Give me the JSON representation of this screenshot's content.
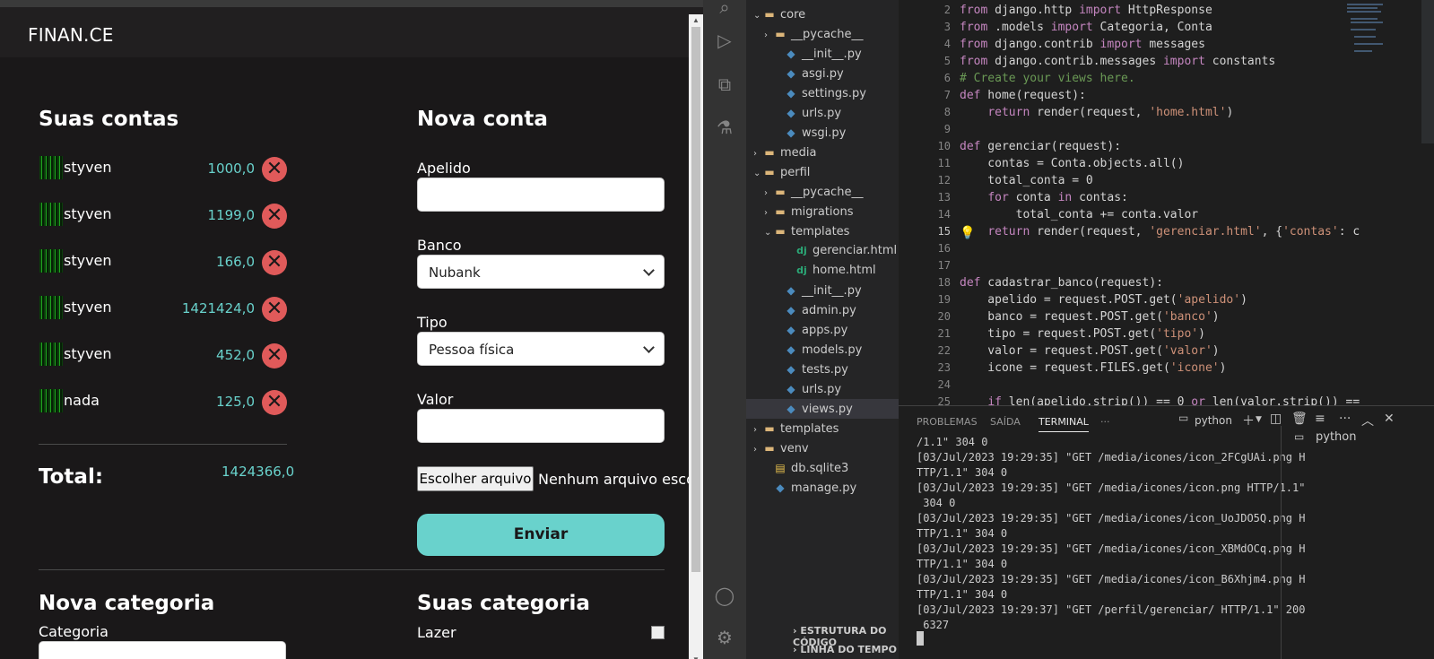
{
  "browser": {
    "brand": "FINAN.CE",
    "accounts_title": "Suas contas",
    "accounts": [
      {
        "name": "styven",
        "value": "1000,0"
      },
      {
        "name": "styven",
        "value": "1199,0"
      },
      {
        "name": "styven",
        "value": "166,0"
      },
      {
        "name": "styven",
        "value": "1421424,0"
      },
      {
        "name": "styven",
        "value": "452,0"
      },
      {
        "name": "nada",
        "value": "125,0"
      }
    ],
    "total_label": "Total:",
    "total_value": "1424366,0",
    "new_account_title": "Nova conta",
    "apelido_label": "Apelido",
    "banco_label": "Banco",
    "banco_value": "Nubank",
    "tipo_label": "Tipo",
    "tipo_value": "Pessoa física",
    "valor_label": "Valor",
    "file_button": "Escolher arquivo",
    "file_status": "Nenhum arquivo escolhido",
    "submit_button": "Enviar",
    "new_category_title": "Nova categoria",
    "category_label": "Categoria",
    "your_categories_title": "Suas categoria",
    "categories": [
      {
        "name": "Lazer"
      }
    ]
  },
  "vscode": {
    "explorer": [
      {
        "label": "core",
        "icon": "folder-icon",
        "twisty": "v"
      },
      {
        "label": "__pycache__",
        "icon": "folder-icon",
        "twisty": ">"
      },
      {
        "label": "__init__.py",
        "icon": "python-icon",
        "twisty": ""
      },
      {
        "label": "asgi.py",
        "icon": "python-icon",
        "twisty": ""
      },
      {
        "label": "settings.py",
        "icon": "python-icon",
        "twisty": ""
      },
      {
        "label": "urls.py",
        "icon": "python-icon",
        "twisty": ""
      },
      {
        "label": "wsgi.py",
        "icon": "python-icon",
        "twisty": ""
      },
      {
        "label": "media",
        "icon": "folder-icon",
        "twisty": ">"
      },
      {
        "label": "perfil",
        "icon": "folder-icon",
        "twisty": "v"
      },
      {
        "label": "__pycache__",
        "icon": "folder-icon",
        "twisty": ">"
      },
      {
        "label": "migrations",
        "icon": "folder-icon",
        "twisty": ">"
      },
      {
        "label": "templates",
        "icon": "folder-icon",
        "twisty": "v"
      },
      {
        "label": "gerenciar.html",
        "icon": "django-icon",
        "twisty": ""
      },
      {
        "label": "home.html",
        "icon": "django-icon",
        "twisty": ""
      },
      {
        "label": "__init__.py",
        "icon": "python-icon",
        "twisty": ""
      },
      {
        "label": "admin.py",
        "icon": "python-icon",
        "twisty": ""
      },
      {
        "label": "apps.py",
        "icon": "python-icon",
        "twisty": ""
      },
      {
        "label": "models.py",
        "icon": "python-icon",
        "twisty": ""
      },
      {
        "label": "tests.py",
        "icon": "python-icon",
        "twisty": ""
      },
      {
        "label": "urls.py",
        "icon": "python-icon",
        "twisty": ""
      },
      {
        "label": "views.py",
        "icon": "python-icon",
        "twisty": "",
        "selected": true
      },
      {
        "label": "templates",
        "icon": "folder-icon",
        "twisty": ">"
      },
      {
        "label": "venv",
        "icon": "folder-icon",
        "twisty": ">"
      },
      {
        "label": "db.sqlite3",
        "icon": "database-icon",
        "twisty": ""
      },
      {
        "label": "manage.py",
        "icon": "python-icon",
        "twisty": ""
      }
    ],
    "sections": [
      "ESTRUTURA DO CÓDIGO",
      "LINHA DO TEMPO"
    ],
    "code": [
      {
        "n": "2",
        "text": "from django.http import HttpResponse"
      },
      {
        "n": "3",
        "text": "from .models import Categoria, Conta"
      },
      {
        "n": "4",
        "text": "from django.contrib import messages"
      },
      {
        "n": "5",
        "text": "from django.contrib.messages import constants"
      },
      {
        "n": "6",
        "text": "# Create your views here."
      },
      {
        "n": "7",
        "text": "def home(request):"
      },
      {
        "n": "8",
        "text": "    return render(request, 'home.html')"
      },
      {
        "n": "9",
        "text": ""
      },
      {
        "n": "10",
        "text": "def gerenciar(request):"
      },
      {
        "n": "11",
        "text": "    contas = Conta.objects.all()"
      },
      {
        "n": "12",
        "text": "    total_conta = 0"
      },
      {
        "n": "13",
        "text": "    for conta in contas:"
      },
      {
        "n": "14",
        "text": "        total_conta += conta.valor"
      },
      {
        "n": "15",
        "text": "    return render(request, 'gerenciar.html', {'contas': c"
      },
      {
        "n": "16",
        "text": ""
      },
      {
        "n": "17",
        "text": ""
      },
      {
        "n": "18",
        "text": "def cadastrar_banco(request):"
      },
      {
        "n": "19",
        "text": "    apelido = request.POST.get('apelido')"
      },
      {
        "n": "20",
        "text": "    banco = request.POST.get('banco')"
      },
      {
        "n": "21",
        "text": "    tipo = request.POST.get('tipo')"
      },
      {
        "n": "22",
        "text": "    valor = request.POST.get('valor')"
      },
      {
        "n": "23",
        "text": "    icone = request.FILES.get('icone')"
      },
      {
        "n": "24",
        "text": ""
      },
      {
        "n": "25",
        "text": "    if len(apelido.strip()) == 0 or len(valor.strip()) =="
      }
    ],
    "panel_tabs": [
      "PROBLEMAS",
      "SAÍDA",
      "TERMINAL",
      "···"
    ],
    "active_tab": "TERMINAL",
    "terminal_name": "python",
    "terminal_instance": "python",
    "terminal_lines": [
      "/1.1\" 304 0",
      "[03/Jul/2023 19:29:35] \"GET /media/icones/icon_2FCgUAi.png H",
      "TTP/1.1\" 304 0",
      "[03/Jul/2023 19:29:35] \"GET /media/icones/icon.png HTTP/1.1\"",
      " 304 0",
      "[03/Jul/2023 19:29:35] \"GET /media/icones/icon_UoJDO5Q.png H",
      "TTP/1.1\" 304 0",
      "[03/Jul/2023 19:29:35] \"GET /media/icones/icon_XBMdOCq.png H",
      "TTP/1.1\" 304 0",
      "[03/Jul/2023 19:29:35] \"GET /media/icones/icon_B6Xhjm4.png H",
      "TTP/1.1\" 304 0",
      "[03/Jul/2023 19:29:37] \"GET /perfil/gerenciar/ HTTP/1.1\" 200",
      " 6327"
    ]
  }
}
